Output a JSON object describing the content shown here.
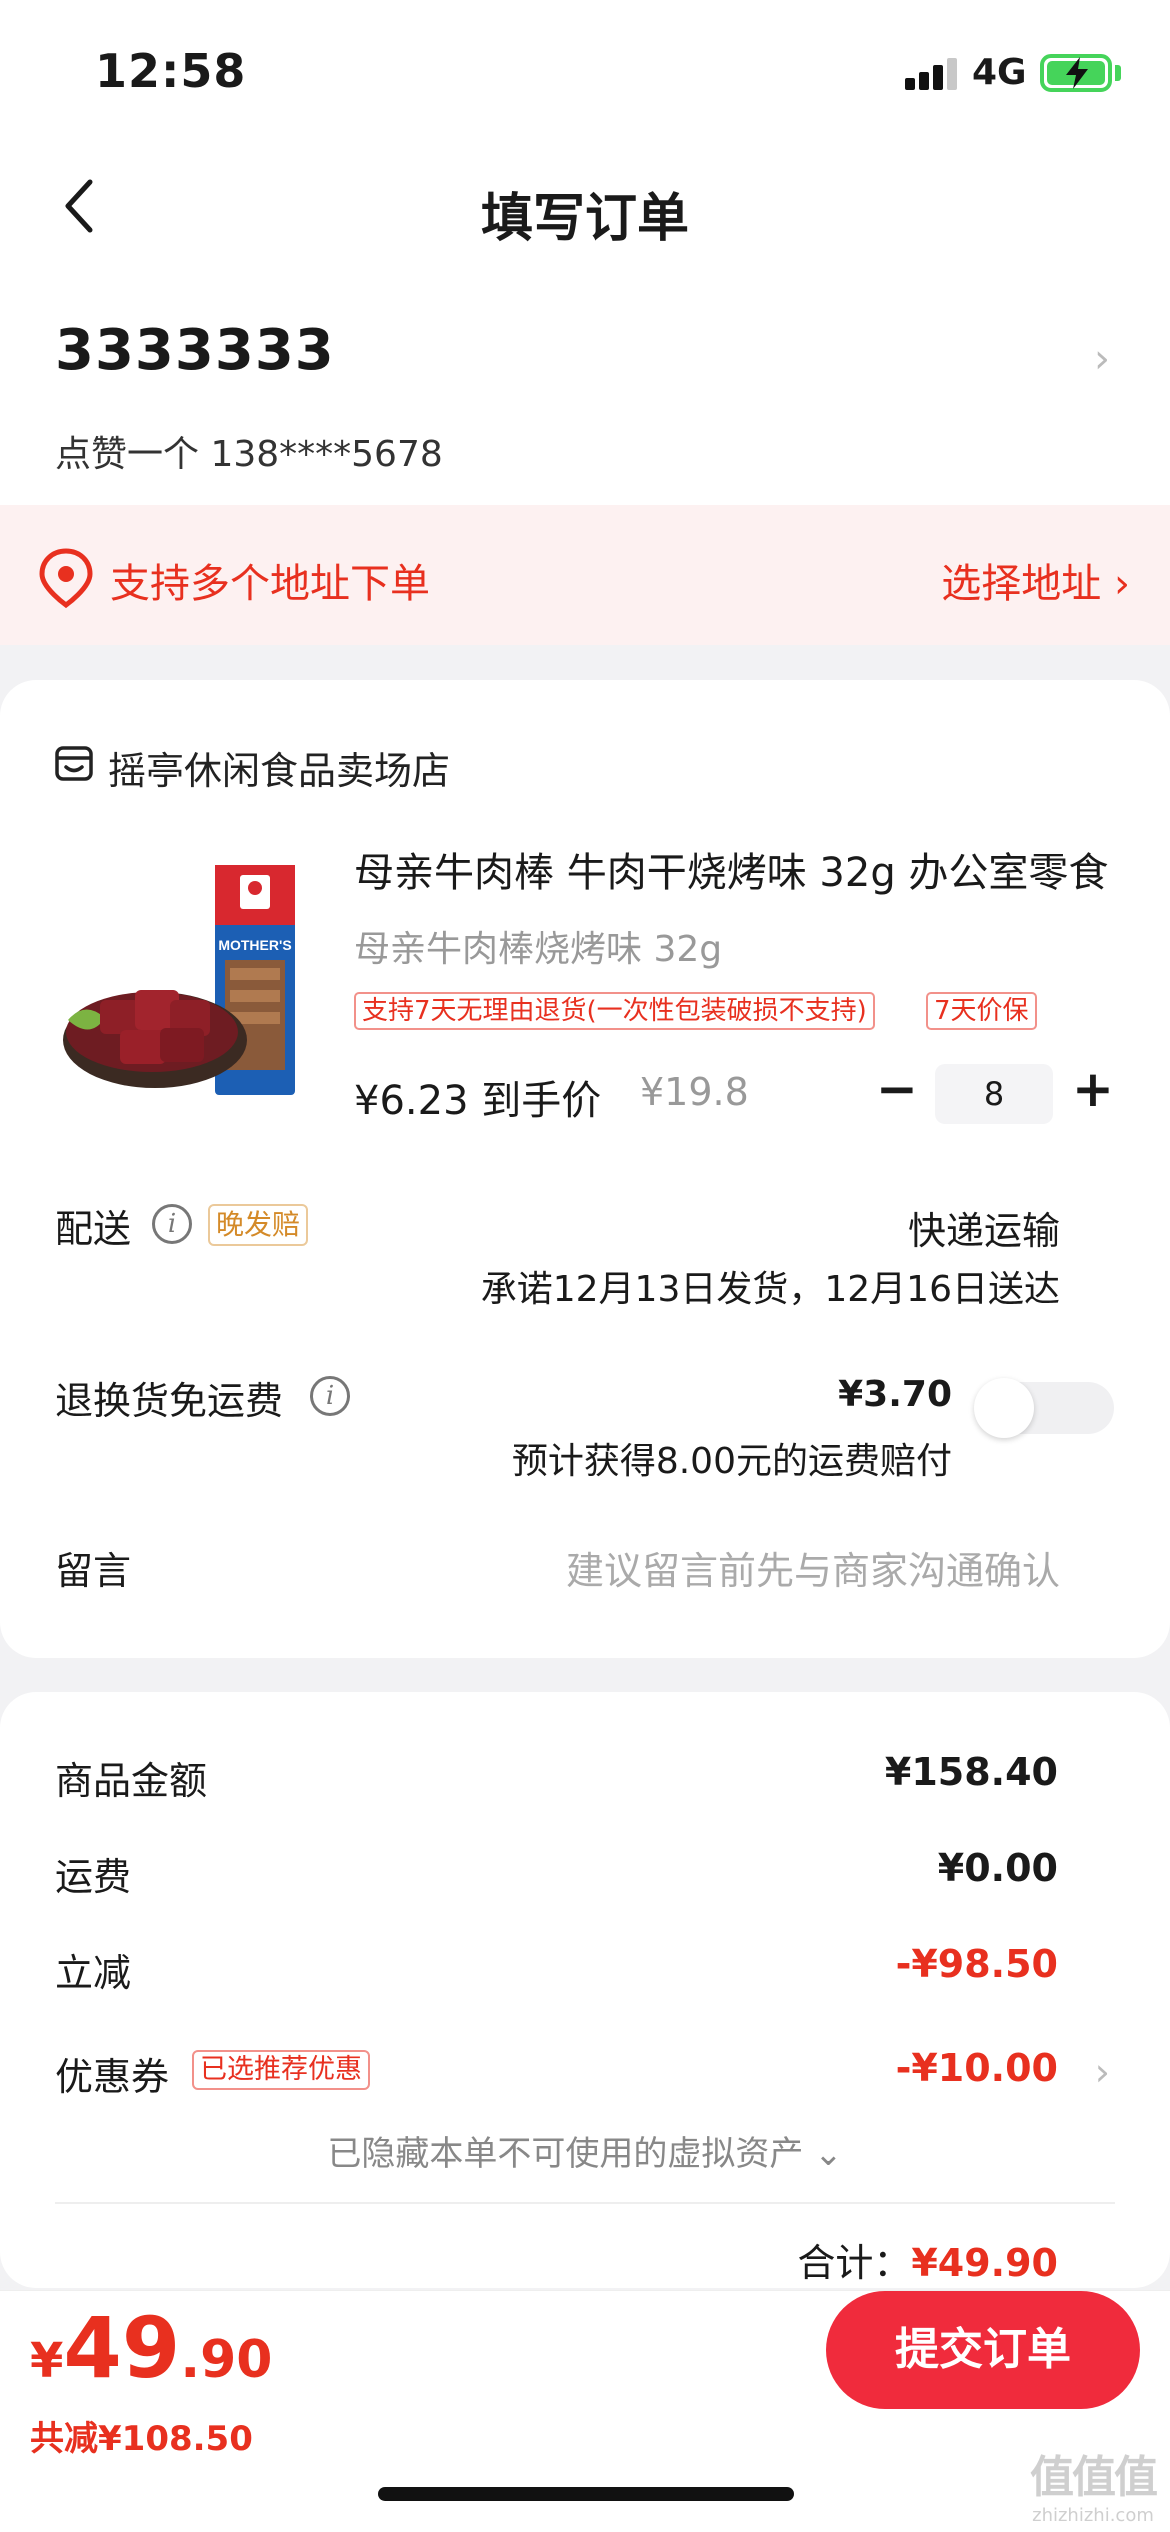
{
  "status_bar": {
    "time": "12:58",
    "network": "4G"
  },
  "nav": {
    "title": "填写订单"
  },
  "address": {
    "line1": "3333333",
    "contact": "点赞一个  138****5678"
  },
  "multi_address": {
    "text": "支持多个地址下单",
    "action": "选择地址 ›"
  },
  "shop": {
    "name": "摇亭休闲食品卖场店",
    "product": {
      "title": "母亲牛肉棒 牛肉干烧烤味 32g 办公室零食",
      "spec": "母亲牛肉棒烧烤味 32g",
      "tags": [
        "支持7天无理由退货(一次性包装破损不支持)",
        "7天价保"
      ],
      "final_price": "¥6.23 到手价",
      "original_price": "¥19.8",
      "quantity": "8",
      "image_alt": "母亲牛肉棒"
    },
    "delivery": {
      "label": "配送",
      "late_badge": "晚发赔",
      "type": "快递运输",
      "promise": "承诺12月13日发货，12月16日送达"
    },
    "freight_insurance": {
      "label": "退换货免运费",
      "price": "¥3.70",
      "note": "预计获得8.00元的运费赔付",
      "enabled": false
    },
    "message": {
      "label": "留言",
      "placeholder": "建议留言前先与商家沟通确认"
    }
  },
  "fees": {
    "goods_label": "商品金额",
    "goods_value": "¥158.40",
    "shipping_label": "运费",
    "shipping_value": "¥0.00",
    "discount_label": "立减",
    "discount_value": "-¥98.50",
    "coupon_label": "优惠券",
    "coupon_badge": "已选推荐优惠",
    "coupon_value": "-¥10.00",
    "hidden_assets": "已隐藏本单不可使用的虚拟资产 ⌄",
    "total_label": "合计：",
    "total_value": "¥49.90"
  },
  "bottom": {
    "pay_yen": "¥",
    "pay_int": "49",
    "pay_dec": ".90",
    "saved": "共减¥108.50",
    "submit": "提交订单"
  },
  "watermark": {
    "logo": "值值值",
    "site": "zhizhizhi.com"
  },
  "colors": {
    "accent": "#e8301f",
    "submit": "#f02b3c",
    "battery": "#45d45a"
  }
}
